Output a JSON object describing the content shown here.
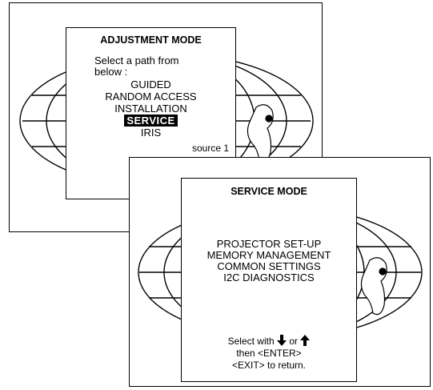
{
  "adjustment": {
    "title": "ADJUSTMENT MODE",
    "prompt_line1": "Select a path from",
    "prompt_line2": "below :",
    "items": [
      {
        "label": "GUIDED"
      },
      {
        "label": "RANDOM ACCESS"
      },
      {
        "label": "INSTALLATION"
      },
      {
        "label": "SERVICE",
        "selected": true
      },
      {
        "label": "IRIS"
      }
    ],
    "source": "source 1"
  },
  "service": {
    "title": "SERVICE MODE",
    "items": [
      {
        "label": "PROJECTOR SET-UP"
      },
      {
        "label": "MEMORY MANAGEMENT"
      },
      {
        "label": "COMMON SETTINGS"
      },
      {
        "label": "I2C DIAGNOSTICS"
      }
    ],
    "help_line1_prefix": "Select with",
    "help_or": "or",
    "help_line2": "then <ENTER>",
    "help_line3": "<EXIT> to return.",
    "icons": [
      "arrow-down-icon",
      "arrow-up-icon"
    ]
  }
}
